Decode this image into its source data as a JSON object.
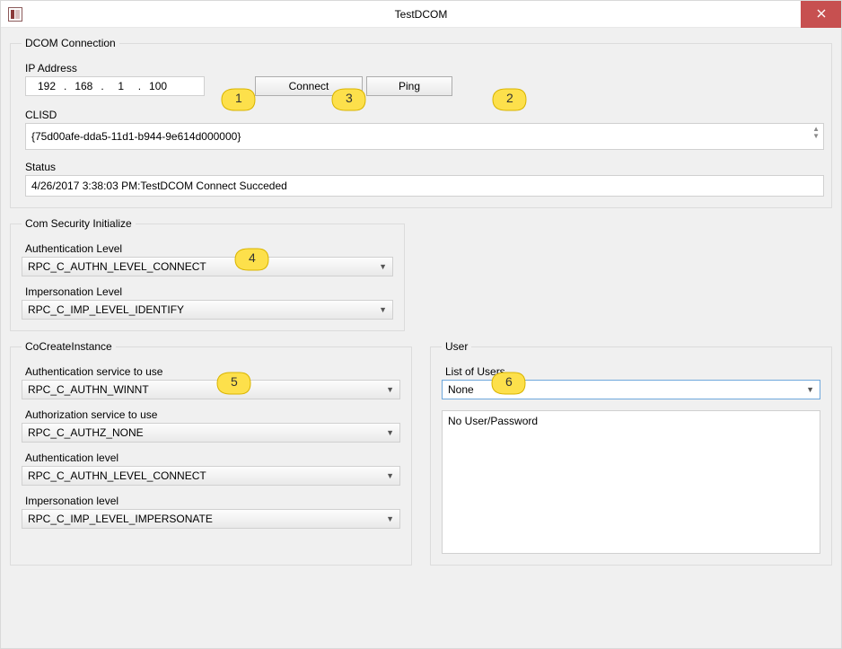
{
  "window": {
    "title": "TestDCOM"
  },
  "dcom": {
    "legend": "DCOM Connection",
    "ip_label": "IP Address",
    "ip": {
      "a": "192",
      "b": "168",
      "c": "1",
      "d": "100"
    },
    "connect_btn": "Connect",
    "ping_btn": "Ping",
    "clisd_label": "CLISD",
    "clisd_value": "{75d00afe-dda5-11d1-b944-9e614d000000}",
    "status_label": "Status",
    "status_value": "4/26/2017 3:38:03 PM:TestDCOM Connect Succeded"
  },
  "com_sec": {
    "legend": "Com Security Initialize",
    "auth_level_label": "Authentication Level",
    "auth_level_value": "RPC_C_AUTHN_LEVEL_CONNECT",
    "imp_level_label": "Impersonation Level",
    "imp_level_value": "RPC_C_IMP_LEVEL_IDENTIFY"
  },
  "cocreate": {
    "legend": "CoCreateInstance",
    "auth_service_label": "Authentication service to use",
    "auth_service_value": "RPC_C_AUTHN_WINNT",
    "authz_service_label": "Authorization service to use",
    "authz_service_value": "RPC_C_AUTHZ_NONE",
    "auth_level_label": "Authentication level",
    "auth_level_value": "RPC_C_AUTHN_LEVEL_CONNECT",
    "imp_level_label": "Impersonation level",
    "imp_level_value": "RPC_C_IMP_LEVEL_IMPERSONATE"
  },
  "user": {
    "legend": "User",
    "list_label": "List of Users",
    "list_value": "None",
    "details": "No User/Password"
  },
  "callouts": {
    "c1": "1",
    "c2": "2",
    "c3": "3",
    "c4": "4",
    "c5": "5",
    "c6": "6"
  }
}
